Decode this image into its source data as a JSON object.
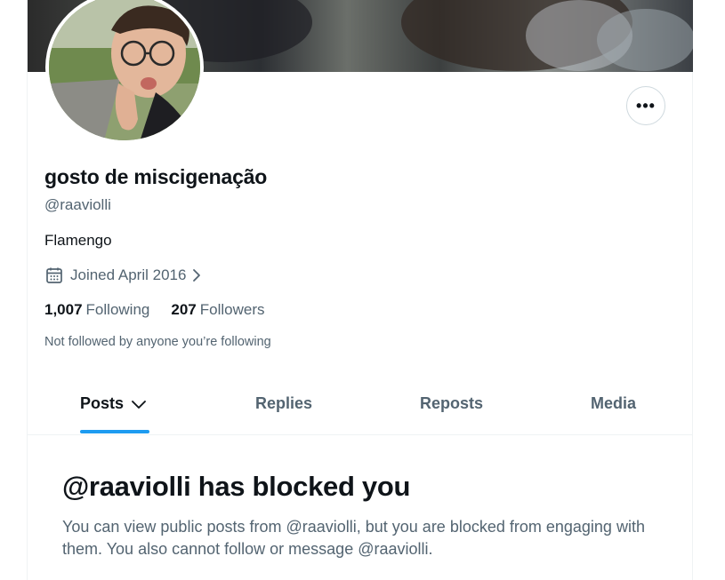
{
  "profile": {
    "display_name": "gosto de miscigenação",
    "handle": "@raaviolli",
    "bio": "Flamengo",
    "joined": "Joined April 2016",
    "following_count": "1,007",
    "following_label": "Following",
    "followers_count": "207",
    "followers_label": "Followers",
    "not_followed_note": "Not followed by anyone you’re following"
  },
  "actions": {
    "more_label": "•••"
  },
  "tabs": [
    {
      "label": "Posts",
      "active": true
    },
    {
      "label": "Replies",
      "active": false
    },
    {
      "label": "Reposts",
      "active": false
    },
    {
      "label": "Media",
      "active": false
    }
  ],
  "blocked": {
    "title": "@raaviolli has blocked you",
    "message": "You can view public posts from @raaviolli, but you are blocked from engaging with them. You also cannot follow or message @raaviolli."
  },
  "colors": {
    "accent": "#1d9bf0",
    "text_primary": "#0f1419",
    "text_secondary": "#536471",
    "border": "#eff3f4"
  },
  "icons": [
    "more-icon",
    "calendar-icon",
    "chevron-right-icon",
    "chevron-down-icon"
  ]
}
